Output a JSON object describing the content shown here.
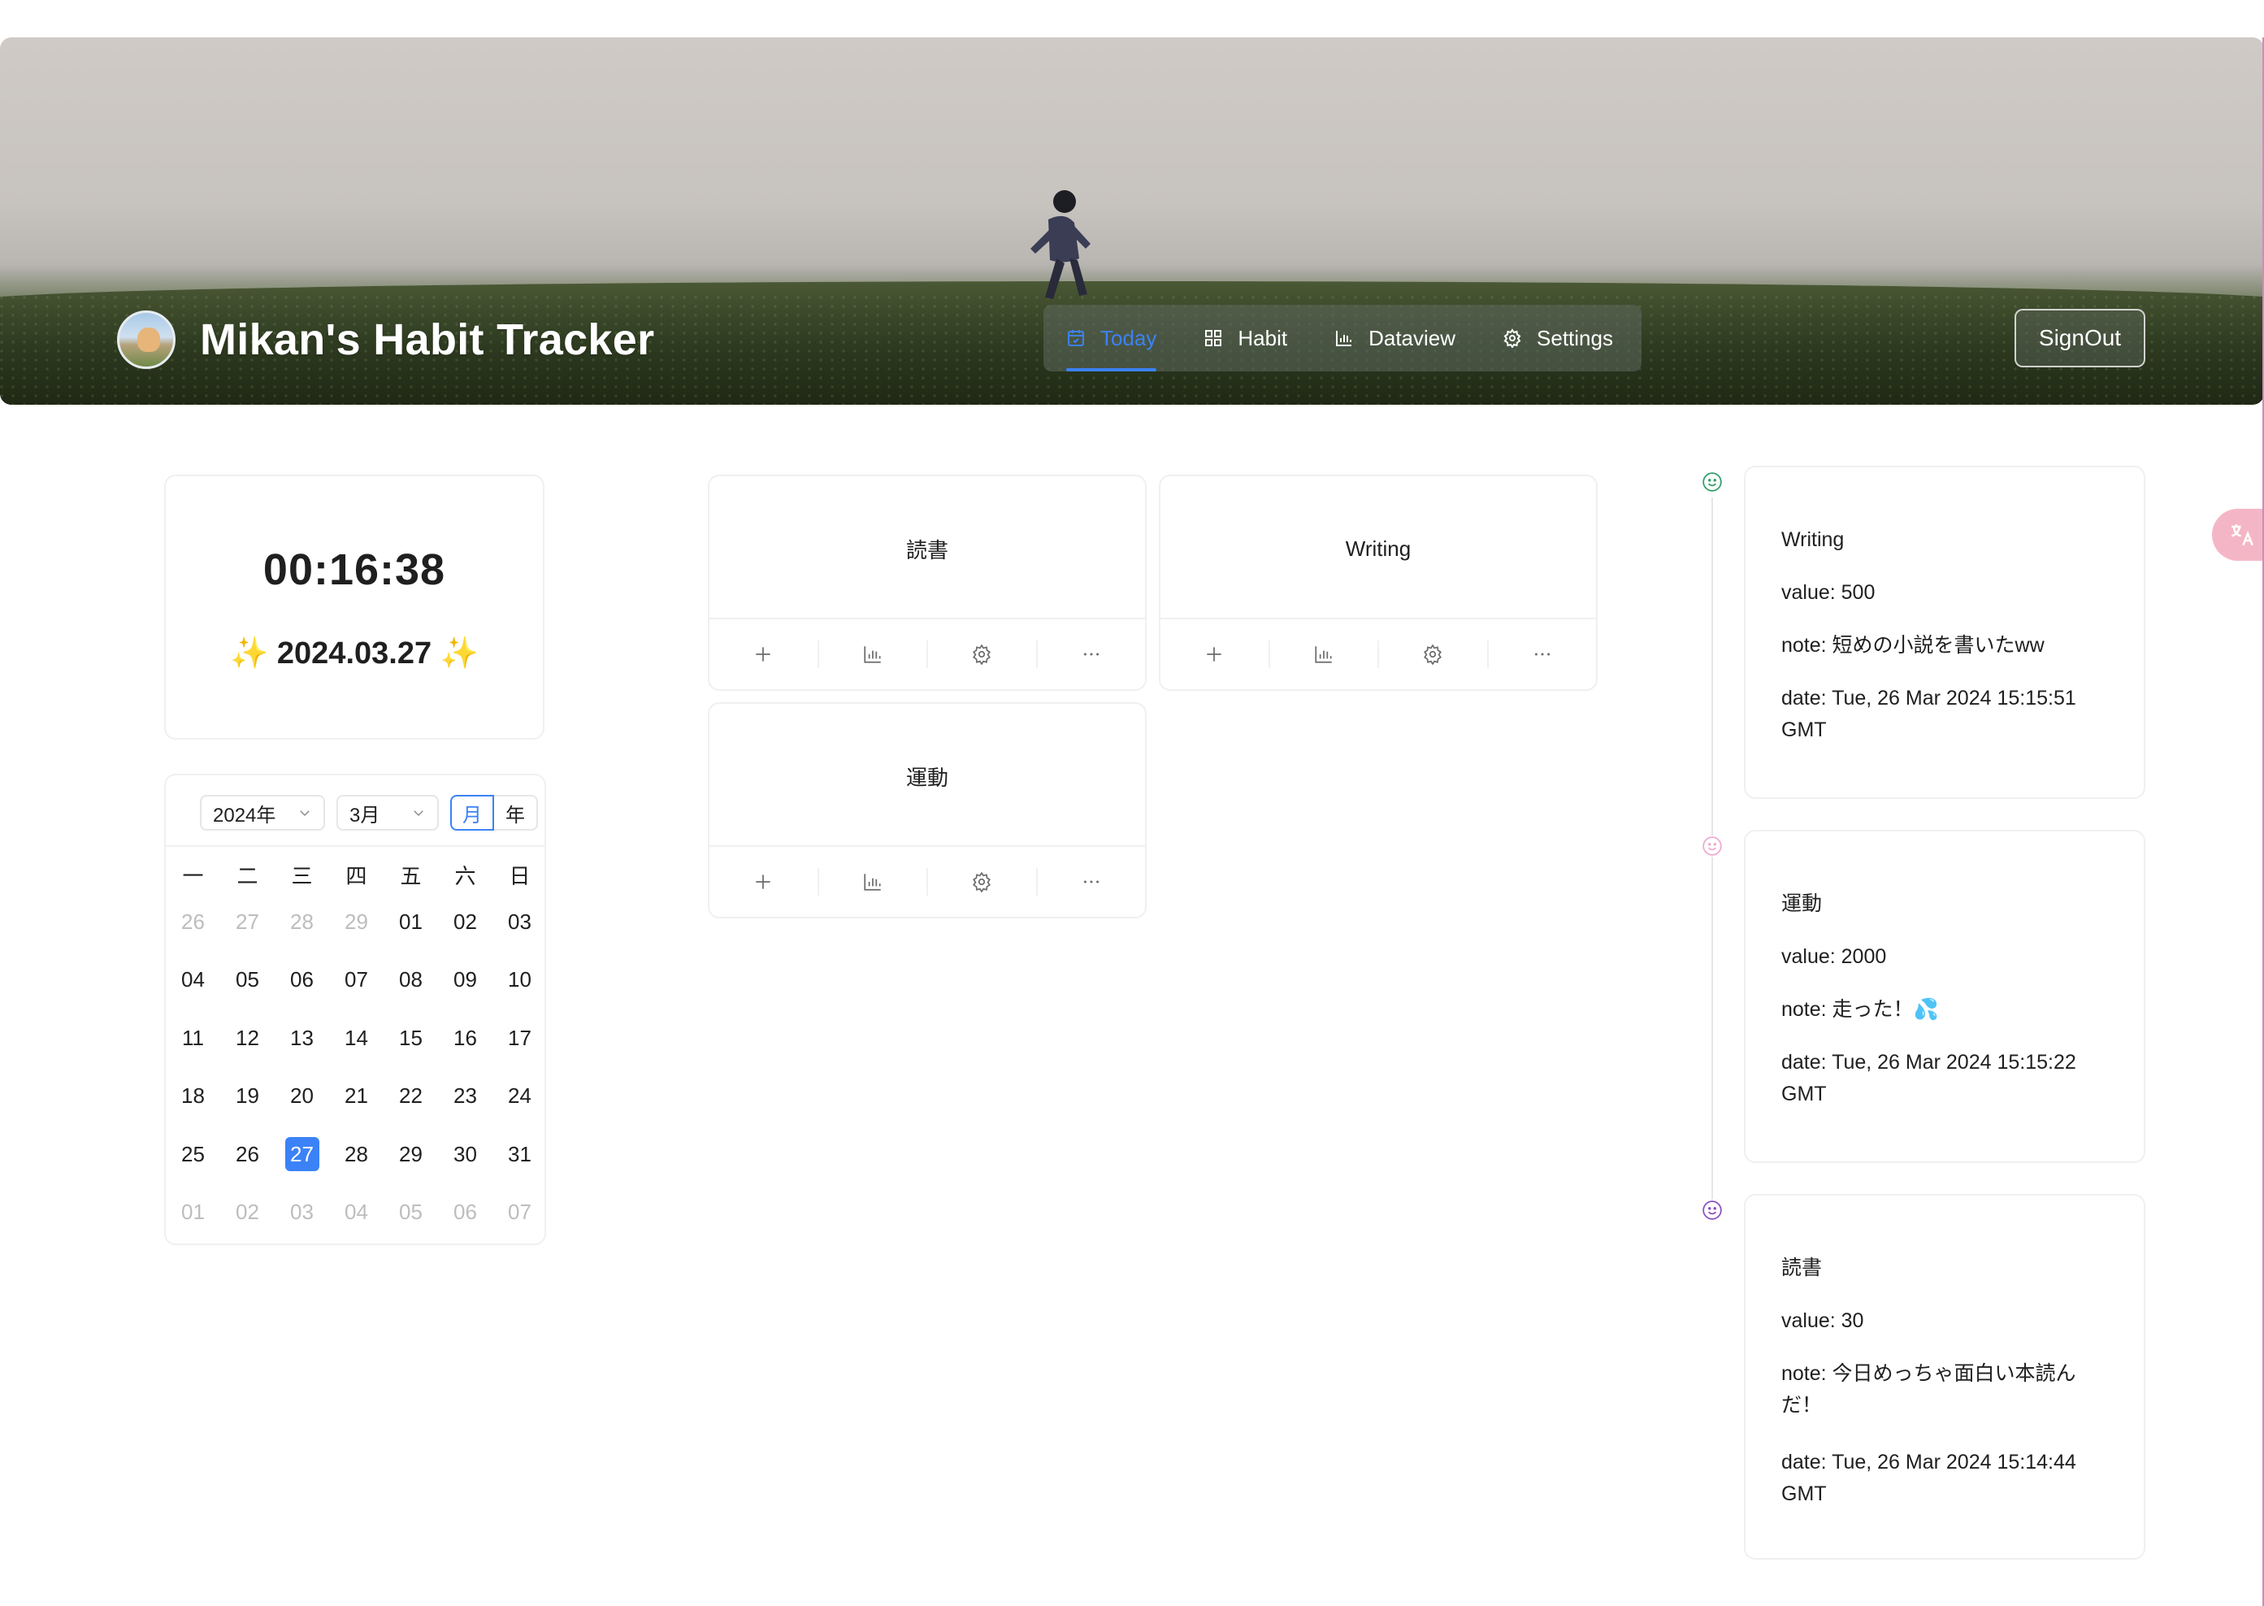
{
  "header": {
    "title": "Mikan's Habit Tracker",
    "signout_label": "SignOut"
  },
  "nav": {
    "items": [
      {
        "label": "Today",
        "icon": "calendar-check-icon",
        "active": true
      },
      {
        "label": "Habit",
        "icon": "grid-icon",
        "active": false
      },
      {
        "label": "Dataview",
        "icon": "bar-chart-icon",
        "active": false
      },
      {
        "label": "Settings",
        "icon": "gear-icon",
        "active": false
      }
    ]
  },
  "clock": {
    "time": "00:16:38",
    "date": "2024.03.27",
    "sparkle": "✨"
  },
  "calendar": {
    "year_select": "2024年",
    "month_select": "3月",
    "mode_month": "月",
    "mode_year": "年",
    "weekdays": [
      "一",
      "二",
      "三",
      "四",
      "五",
      "六",
      "日"
    ],
    "weeks": [
      [
        "26",
        "27",
        "28",
        "29",
        "01",
        "02",
        "03"
      ],
      [
        "04",
        "05",
        "06",
        "07",
        "08",
        "09",
        "10"
      ],
      [
        "11",
        "12",
        "13",
        "14",
        "15",
        "16",
        "17"
      ],
      [
        "18",
        "19",
        "20",
        "21",
        "22",
        "23",
        "24"
      ],
      [
        "25",
        "26",
        "27",
        "28",
        "29",
        "30",
        "31"
      ],
      [
        "01",
        "02",
        "03",
        "04",
        "05",
        "06",
        "07"
      ]
    ],
    "selected": "27"
  },
  "habits": [
    {
      "name": "読書"
    },
    {
      "name": "Writing"
    },
    {
      "name": "運動"
    }
  ],
  "logs": [
    {
      "title": "Writing",
      "value": "value: 500",
      "note": "note: 短めの小説を書いたww",
      "date": "date: Tue, 26 Mar 2024 15:15:51 GMT",
      "dot_color": "#2e9e6a"
    },
    {
      "title": "運動",
      "value": "value: 2000",
      "note": "note: 走った！💦",
      "date": "date: Tue, 26 Mar 2024 15:15:22 GMT",
      "dot_color": "#f0a8d0"
    },
    {
      "title": "読書",
      "value": "value: 30",
      "note": "note: 今日めっちゃ面白い本読んだ！",
      "date": "date: Tue, 26 Mar 2024 15:14:44 GMT",
      "dot_color": "#8a4fc1"
    }
  ],
  "colors": {
    "accent": "#3b82f6",
    "border": "#f0f0f0",
    "text": "#1f1f1f",
    "muted": "#bdbdbd"
  }
}
